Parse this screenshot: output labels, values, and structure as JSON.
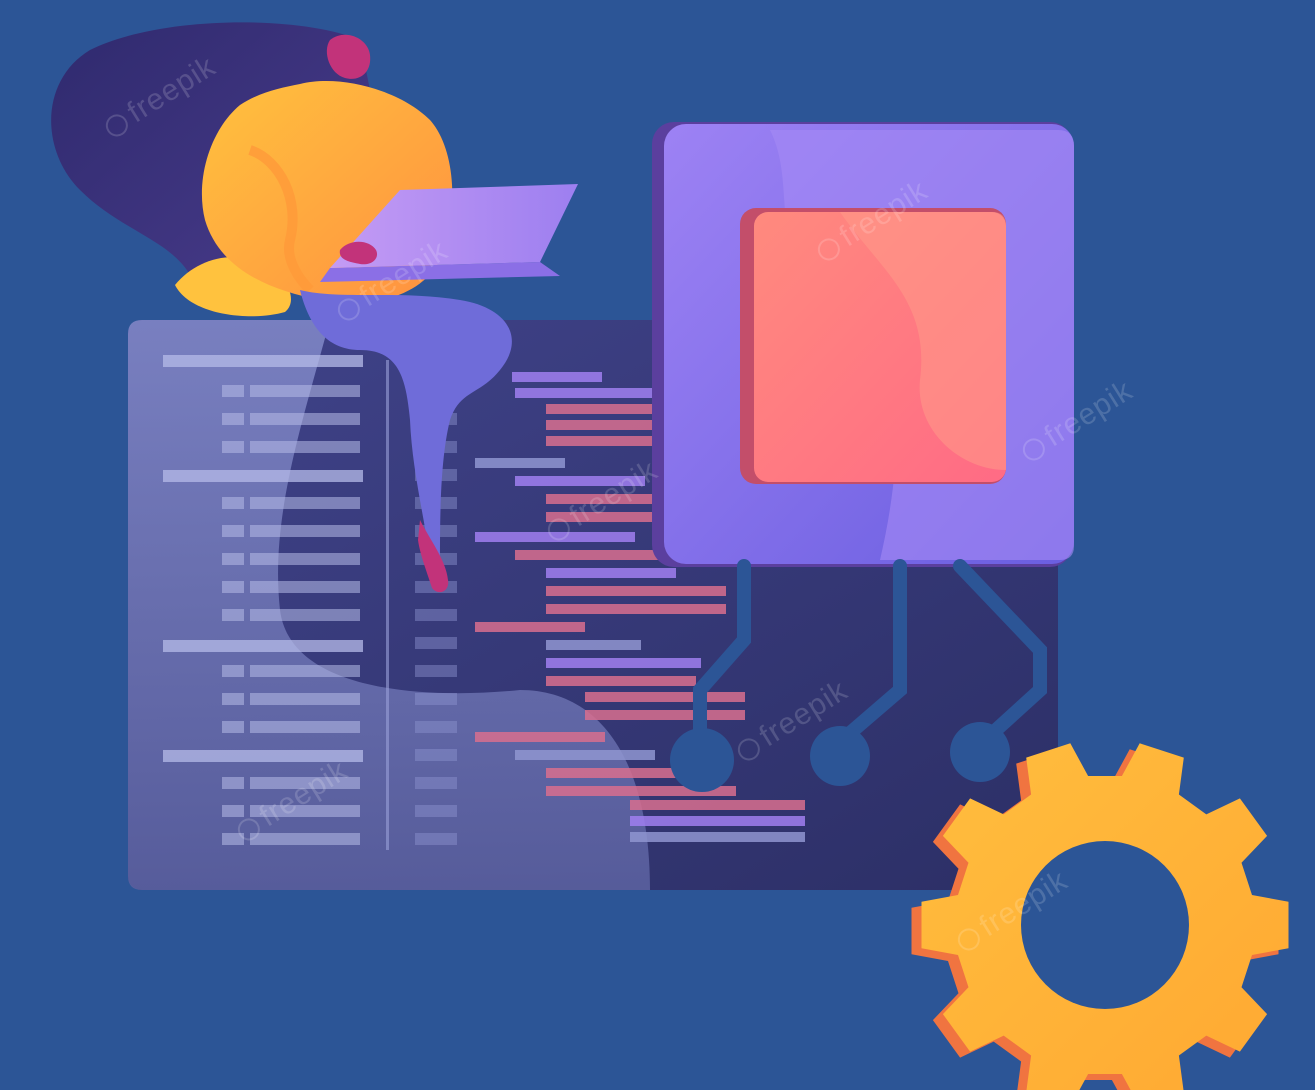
{
  "watermark": {
    "text": "freepik",
    "icon": "freepik-logo-icon",
    "color": "rgba(255,255,255,0.16)"
  },
  "colors": {
    "background": "#2c5596",
    "code_panel": "#3b3d78",
    "chip_frame": "#8a73e8",
    "chip_core": "#ff7a86",
    "gear": "#ffb13a",
    "gear_shadow": "#f07440",
    "person_shirt": "#ffa33a",
    "person_hair": "#3a3079",
    "person_pants": "#6d6ad8",
    "laptop": "#b48cf2",
    "code_line_primary": "#a07ff0",
    "code_line_secondary": "#d86e8e"
  }
}
